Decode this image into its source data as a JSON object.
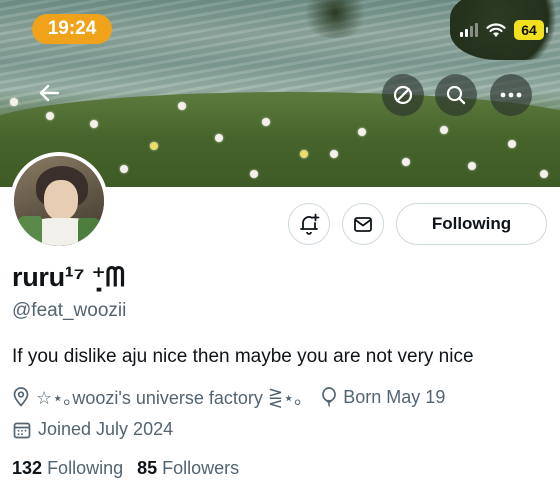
{
  "status_bar": {
    "time": "19:24",
    "battery": "64"
  },
  "profile": {
    "display_name": "ruru¹⁷ ⁺̣ᗰ",
    "handle": "@feat_woozii",
    "bio": "If you dislike aju nice then maybe you are not very nice",
    "location": "☆⋆｡woozi's universe factory ⋛⋆｡",
    "birthday": "Born May 19",
    "joined": "Joined July 2024",
    "following_count": "132",
    "following_label": "Following",
    "followers_count": "85",
    "followers_label": "Followers"
  },
  "actions": {
    "follow_state_label": "Following"
  },
  "icons": {
    "back": "arrow-left-icon",
    "block": "block-icon",
    "search": "search-icon",
    "more": "more-icon",
    "notify": "bell-plus-icon",
    "message": "envelope-icon",
    "location": "location-pin-icon",
    "birthday": "balloon-icon",
    "joined": "calendar-icon"
  },
  "colors": {
    "time_pill": "#f0a21a",
    "battery": "#f1e01f",
    "secondary_text": "#536471",
    "border": "#cfd9de"
  }
}
